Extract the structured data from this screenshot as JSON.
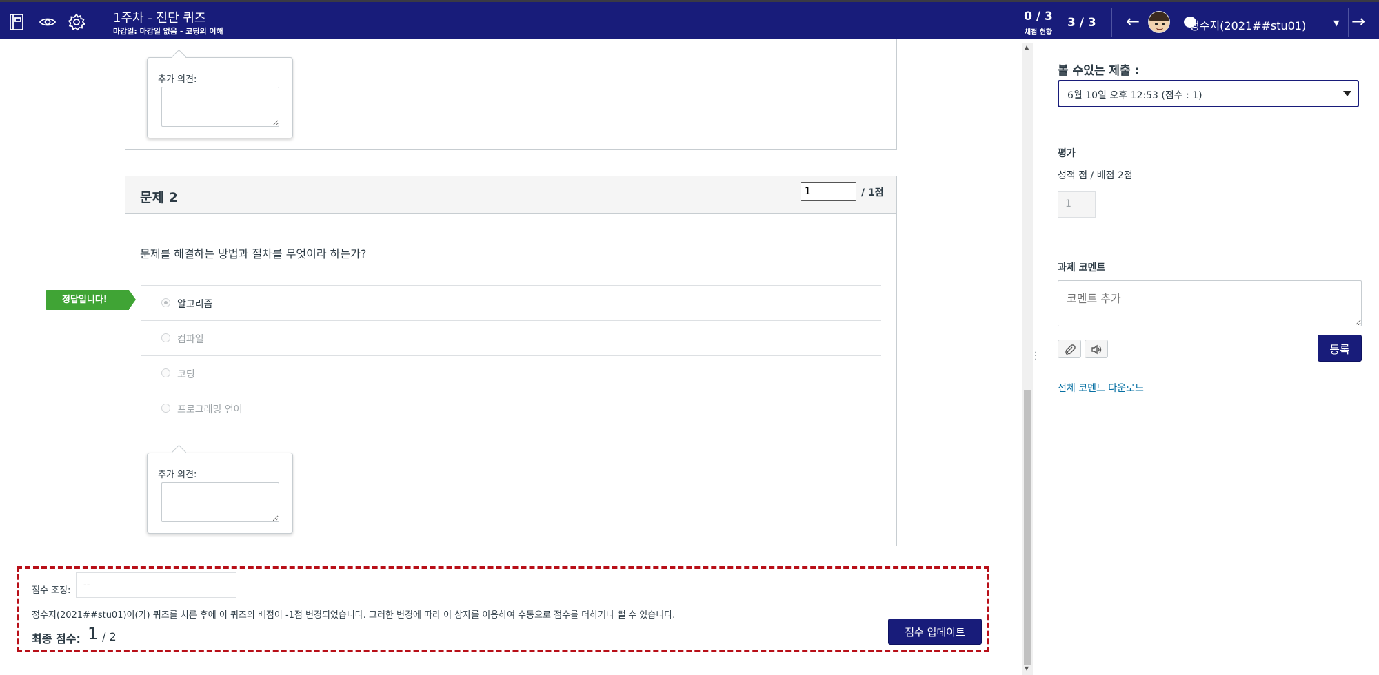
{
  "header": {
    "title": "1주차 - 진단 퀴즈",
    "subtitle": "마감일: 마감일 없음 - 코딩의 이해",
    "graded_count": "0 / 3",
    "graded_label": "채점 현황",
    "student_index": "3 / 3",
    "student_name": "정수지(2021##stu01)",
    "prev_arrow": "←",
    "next_arrow": "→",
    "caret": "▼",
    "icons": [
      "gradebook-icon",
      "eye-icon",
      "gear-icon"
    ]
  },
  "question1": {
    "comment_label": "추가 의견:"
  },
  "question2": {
    "title": "문제 2",
    "points_value": "1",
    "points_max": "/ 1점",
    "text": "문제를 해결하는 방법과 절차를 무엇이라 하는가?",
    "correct_flag": "정답입니다!",
    "answers": [
      {
        "label": "알고리즘",
        "selected": true,
        "correct": true
      },
      {
        "label": "컴파일",
        "selected": false,
        "correct": false
      },
      {
        "label": "코딩",
        "selected": false,
        "correct": false
      },
      {
        "label": "프로그래밍 언어",
        "selected": false,
        "correct": false
      }
    ],
    "comment_label": "추가 의견:"
  },
  "score_box": {
    "adjust_label": "점수 조정:",
    "adjust_placeholder": "--",
    "note": "정수지(2021##stu01)이(가) 퀴즈를 치른 후에 이 퀴즈의 배점이 -1점 변경되었습니다. 그러한 변경에 따라 이 상자를 이용하여 수동으로 점수를 더하거나 뺄 수 있습니다.",
    "final_label": "최종 점수:",
    "final_value": "1",
    "final_max": "/ 2",
    "update_button": "점수 업데이트"
  },
  "right_panel": {
    "submissions_label": "볼 수있는 제출 :",
    "submission_selected": "6월 10일 오후 12:53 (점수 : 1)",
    "assessment_label": "평가",
    "grade_text": "성적 점 / 배점 2점",
    "grade_value": "1",
    "comment_heading": "과제 코멘트",
    "comment_placeholder": "코멘트 추가",
    "submit_button": "등록",
    "download_link": "전체 코멘트 다운로드",
    "tool_icons": [
      "paperclip-icon",
      "speaker-icon"
    ]
  },
  "colors": {
    "header_bg": "#181c7a",
    "correct_flag": "#40a435",
    "score_box_border": "#b80f18",
    "link": "#0770a3"
  }
}
